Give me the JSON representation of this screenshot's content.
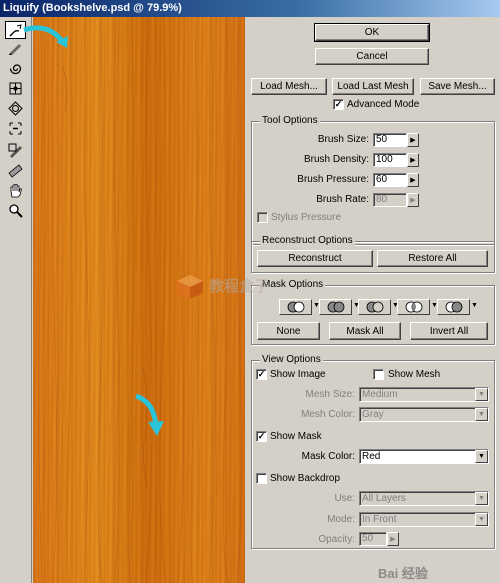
{
  "window": {
    "title": "Liquify (Bookshelve.psd @ 79.9%)"
  },
  "tools": [
    {
      "name": "forward-warp-tool-icon",
      "active": true
    },
    {
      "name": "reconstruct-tool-icon"
    },
    {
      "name": "twirl-tool-icon"
    },
    {
      "name": "pucker-tool-icon"
    },
    {
      "name": "bloat-tool-icon"
    },
    {
      "name": "push-left-tool-icon"
    },
    {
      "name": "freeze-mask-tool-icon"
    },
    {
      "name": "thaw-mask-tool-icon"
    },
    {
      "name": "hand-tool-icon"
    },
    {
      "name": "zoom-tool-icon"
    }
  ],
  "buttons": {
    "ok": "OK",
    "cancel": "Cancel",
    "load_mesh": "Load Mesh...",
    "load_last_mesh": "Load Last Mesh",
    "save_mesh": "Save Mesh..."
  },
  "advanced_mode": {
    "label": "Advanced Mode",
    "checked": true
  },
  "tool_options": {
    "title": "Tool Options",
    "brush_size": {
      "label": "Brush Size:",
      "value": "50"
    },
    "brush_density": {
      "label": "Brush Density:",
      "value": "100"
    },
    "brush_pressure": {
      "label": "Brush Pressure:",
      "value": "60"
    },
    "brush_rate": {
      "label": "Brush Rate:",
      "value": "80"
    },
    "stylus_pressure": {
      "label": "Stylus Pressure",
      "checked": false
    }
  },
  "reconstruct_options": {
    "title": "Reconstruct Options",
    "reconstruct": "Reconstruct",
    "restore_all": "Restore All"
  },
  "mask_options": {
    "title": "Mask Options",
    "none": "None",
    "mask_all": "Mask All",
    "invert_all": "Invert All"
  },
  "view_options": {
    "title": "View Options",
    "show_image": {
      "label": "Show Image",
      "checked": true
    },
    "show_mesh": {
      "label": "Show Mesh",
      "checked": false
    },
    "mesh_size": {
      "label": "Mesh Size:",
      "value": "Medium"
    },
    "mesh_color": {
      "label": "Mesh Color:",
      "value": "Gray"
    },
    "show_mask": {
      "label": "Show Mask",
      "checked": true
    },
    "mask_color": {
      "label": "Mask Color:",
      "value": "Red"
    },
    "show_backdrop": {
      "label": "Show Backdrop",
      "checked": false
    },
    "use": {
      "label": "Use:",
      "value": "All Layers"
    },
    "mode": {
      "label": "Mode:",
      "value": "In Front"
    },
    "opacity": {
      "label": "Opacity:",
      "value": "50"
    }
  },
  "watermark": {
    "logo_text": "教程盒子",
    "corner_text": "Bai 经验"
  },
  "colors": {
    "annotation_arrow": "#29c4d8",
    "wood": "#e08a1c"
  }
}
